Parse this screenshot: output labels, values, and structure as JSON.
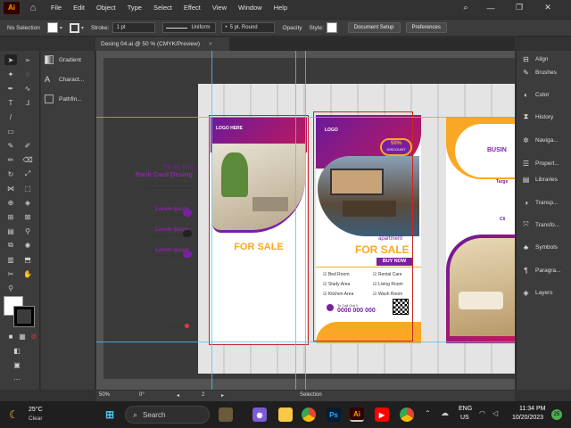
{
  "menubar": {
    "app_logo": "Ai",
    "items": [
      "File",
      "Edit",
      "Object",
      "Type",
      "Select",
      "Effect",
      "View",
      "Window",
      "Help"
    ]
  },
  "control_bar": {
    "selection": "No Selection",
    "stroke_label": "Stroke:",
    "stroke_value": "1 pt",
    "profile": "Uniform",
    "brush": "5 pt. Round",
    "opacity_label": "Opacity",
    "style_label": "Style:",
    "document_setup": "Document Setup",
    "preferences": "Preferences"
  },
  "document_tab": {
    "title": "Desing 04.ai @ 50 % (CMYK/Preview)",
    "close": "×"
  },
  "left_panel": {
    "items": [
      "Gradient",
      "Charact...",
      "Pathfin..."
    ]
  },
  "right_panel": {
    "items": [
      "Align",
      "Brushes",
      "Color",
      "History",
      "Naviga...",
      "Propert...",
      "Libraries",
      "Transp...",
      "Transfo...",
      "Symbols",
      "Paragra...",
      "Layers"
    ]
  },
  "artwork": {
    "my_first": "This My First",
    "title": "Rack Card Desing",
    "subtitle1": "This My Fast Rack Card Desing",
    "subtitle2": "This My Fast Rack Card Desing",
    "lorem1": "Lorem Ipsum",
    "lorem2": "Lorem Ipsum",
    "lorem3": "Lorem Ipsum",
    "lorem_sub": "Lorem Ipsum Dolor Sit",
    "card1_logo": "LOGO HERE",
    "card1_forsale": "FOR SALE",
    "card2_logo": "LOGO",
    "discount_pct": "50%",
    "discount_label": "DISCOUNT",
    "apartment": "apartment",
    "forsale": "FOR SALE",
    "buy_now": "BUY NOW",
    "features": [
      "Bed Room",
      "Rental Care",
      "Study Area",
      "Living Room",
      "Kitchen Area",
      "Wash Room"
    ],
    "call_label": "To Call Out !!",
    "phone": "0000 000 000",
    "card3_busin": "BUSIN",
    "card3_targ": "Targe",
    "card3_cli": "Cli",
    "tiny_phone": "111-222-333"
  },
  "status_bar": {
    "zoom": "50%",
    "rotation": "0°",
    "artboard": "2",
    "mode": "Selection"
  },
  "taskbar": {
    "weather_temp": "25°C",
    "weather_desc": "Clear",
    "search": "Search",
    "lang": "ENG",
    "region": "US",
    "time": "11:34 PM",
    "date": "10/20/2023",
    "badge": "25"
  },
  "colors": {
    "purple": "#7b1fa2",
    "magenta": "#c2185b",
    "yellow": "#f9a825",
    "guide": "#4fc3f7"
  }
}
